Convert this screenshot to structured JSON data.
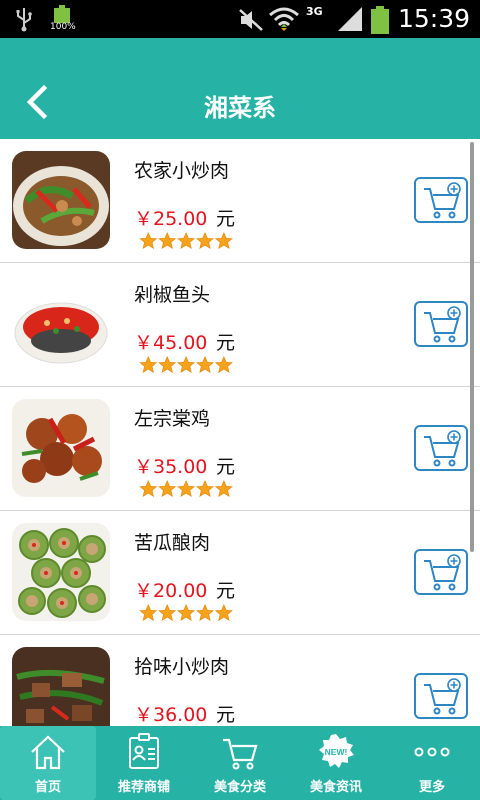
{
  "status_bar": {
    "battery_small_percent": "100%",
    "network": "3G",
    "time": "15:39"
  },
  "header": {
    "title": "湘菜系"
  },
  "dishes": [
    {
      "name": "农家小炒肉",
      "price": "￥25.00",
      "unit": "元",
      "rating": 5
    },
    {
      "name": "剁椒鱼头",
      "price": "￥45.00",
      "unit": "元",
      "rating": 5
    },
    {
      "name": "左宗棠鸡",
      "price": "￥35.00",
      "unit": "元",
      "rating": 5
    },
    {
      "name": "苦瓜酿肉",
      "price": "￥20.00",
      "unit": "元",
      "rating": 5
    },
    {
      "name": "拾味小炒肉",
      "price": "￥36.00",
      "unit": "元",
      "rating": 5
    }
  ],
  "bottom_nav": {
    "items": [
      {
        "label": "首页",
        "icon": "home-icon",
        "active": true
      },
      {
        "label": "推荐商铺",
        "icon": "shop-id-card-icon",
        "active": false
      },
      {
        "label": "美食分类",
        "icon": "cart-icon",
        "active": false
      },
      {
        "label": "美食资讯",
        "icon": "new-badge-icon",
        "active": false
      },
      {
        "label": "更多",
        "icon": "more-dots-icon",
        "active": false
      }
    ],
    "new_badge_text": "NEW!"
  },
  "colors": {
    "teal": "#26b3a6",
    "price_red": "#e6141e",
    "cart_blue": "#2f86c4",
    "star_orange": "#f7a21b"
  }
}
